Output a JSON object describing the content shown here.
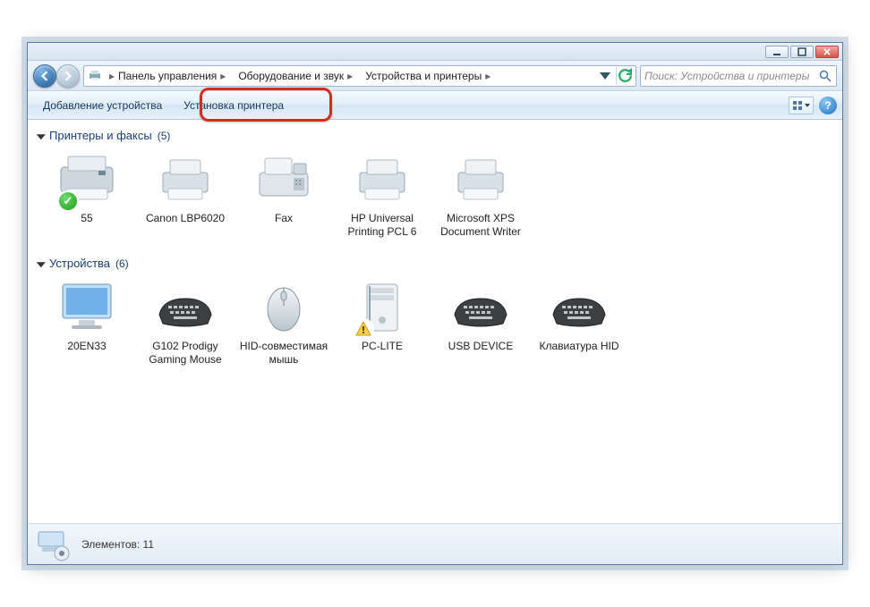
{
  "titlebar": {},
  "breadcrumb": {
    "root": "Панель управления",
    "mid": "Оборудование и звук",
    "leaf": "Устройства и принтеры"
  },
  "search": {
    "placeholder": "Поиск: Устройства и принтеры"
  },
  "toolbar": {
    "add_device": "Добавление устройства",
    "install_printer": "Установка принтера"
  },
  "groups": [
    {
      "name": "Принтеры и факсы",
      "count": "(5)",
      "items": [
        {
          "label": "55",
          "kind": "printer-big",
          "overlay": "ok"
        },
        {
          "label": "Canon LBP6020",
          "kind": "printer"
        },
        {
          "label": "Fax",
          "kind": "fax"
        },
        {
          "label": "HP Universal Printing PCL 6",
          "kind": "printer"
        },
        {
          "label": "Microsoft XPS Document Writer",
          "kind": "printer"
        }
      ]
    },
    {
      "name": "Устройства",
      "count": "(6)",
      "items": [
        {
          "label": "20EN33",
          "kind": "monitor"
        },
        {
          "label": "G102 Prodigy Gaming Mouse",
          "kind": "keyboard"
        },
        {
          "label": "HID-совместимая мышь",
          "kind": "mouse"
        },
        {
          "label": "PC-LITE",
          "kind": "tower",
          "overlay": "warn"
        },
        {
          "label": "USB DEVICE",
          "kind": "keyboard"
        },
        {
          "label": "Клавиатура HID",
          "kind": "keyboard"
        }
      ]
    }
  ],
  "status": {
    "count_label": "Элементов: 11"
  }
}
